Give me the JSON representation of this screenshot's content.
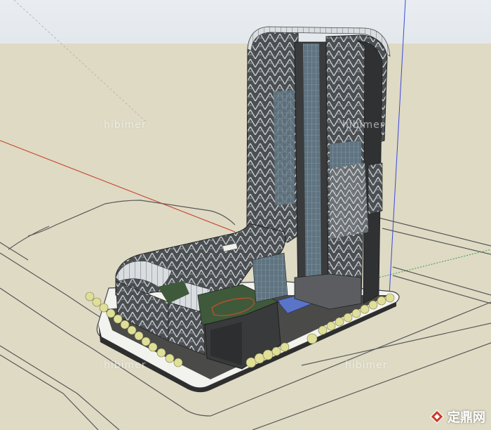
{
  "viewport": {
    "sky_color": "#e6ebef",
    "ground_color": "#dedac4"
  },
  "axes": {
    "red_axis_color": "#c83a2a",
    "green_axis_color": "#3aa04a",
    "blue_axis_color": "#3b48d8"
  },
  "watermarks": {
    "wm1": "hibimer",
    "wm2": "hibimer",
    "wm3": "hibimer",
    "wm4": "hibimer"
  },
  "logo": {
    "text": "定鼎网",
    "mark_icon": "diamond-logo-icon",
    "mark_color": "#c83a2a"
  },
  "model": {
    "tower_dark": "#3a3c3e",
    "podium_roof_green": "#3f5a3a",
    "pool_color": "#5a74c8",
    "tree_color": "#e0df9a"
  }
}
